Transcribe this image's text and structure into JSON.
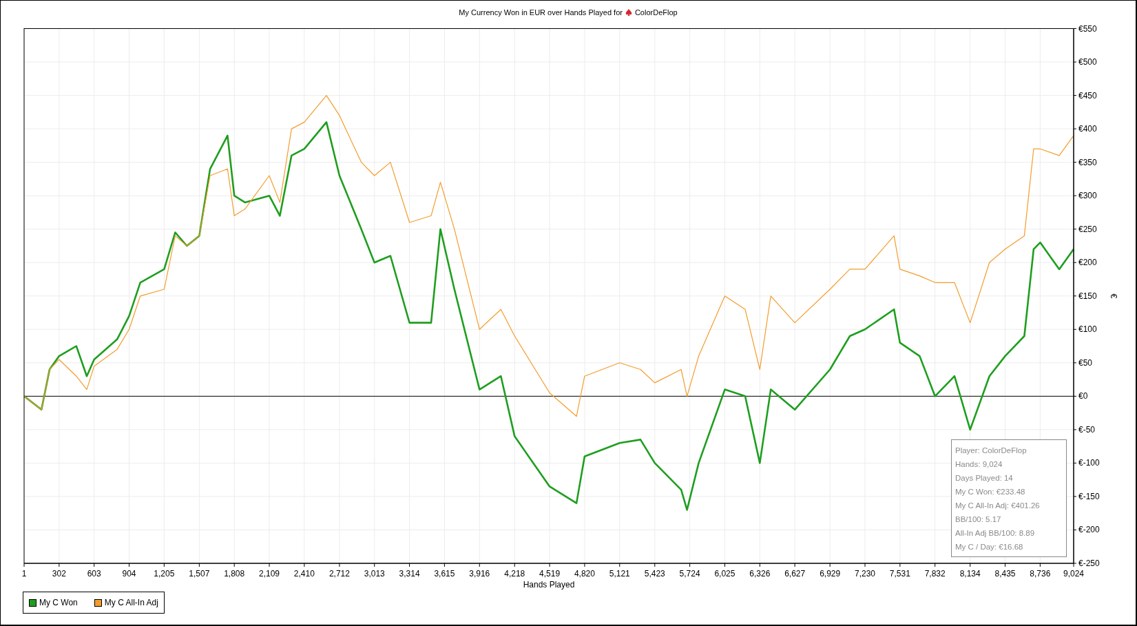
{
  "chart": {
    "chart_data": {
      "type": "line",
      "title": "My Currency Won in EUR over Hands Played for",
      "xlabel": "Hands Played",
      "ylabel": "€",
      "x": [
        1,
        150,
        220,
        302,
        450,
        540,
        603,
        800,
        904,
        1000,
        1205,
        1300,
        1400,
        1507,
        1600,
        1750,
        1808,
        1900,
        2109,
        2200,
        2300,
        2410,
        2600,
        2712,
        2900,
        3013,
        3150,
        3314,
        3500,
        3580,
        3700,
        3916,
        4100,
        4218,
        4519,
        4750,
        4820,
        5121,
        5300,
        5423,
        5650,
        5700,
        5800,
        6025,
        6200,
        6326,
        6420,
        6627,
        6929,
        7100,
        7230,
        7480,
        7531,
        7700,
        7832,
        8000,
        8134,
        8300,
        8435,
        8600,
        8680,
        8736,
        8900,
        9024
      ],
      "series": [
        {
          "name": "My C Won",
          "color": "#1e9e1e",
          "values": [
            0,
            -20,
            40,
            60,
            75,
            30,
            55,
            85,
            120,
            170,
            190,
            245,
            225,
            240,
            340,
            390,
            300,
            290,
            300,
            270,
            360,
            370,
            410,
            330,
            250,
            200,
            210,
            110,
            110,
            250,
            160,
            10,
            30,
            -60,
            -135,
            -160,
            -90,
            -70,
            -65,
            -100,
            -140,
            -170,
            -100,
            10,
            0,
            -100,
            10,
            -20,
            40,
            90,
            100,
            130,
            80,
            60,
            0,
            30,
            -50,
            30,
            60,
            90,
            220,
            230,
            190,
            220
          ]
        },
        {
          "name": "My C All-In Adj",
          "color": "#f39c2c",
          "values": [
            0,
            -20,
            40,
            55,
            30,
            10,
            45,
            70,
            100,
            150,
            160,
            240,
            225,
            240,
            330,
            340,
            270,
            280,
            330,
            290,
            400,
            410,
            450,
            420,
            350,
            330,
            350,
            260,
            270,
            320,
            250,
            100,
            130,
            90,
            5,
            -30,
            30,
            50,
            40,
            20,
            40,
            0,
            60,
            150,
            130,
            40,
            150,
            110,
            160,
            190,
            190,
            240,
            190,
            180,
            170,
            170,
            110,
            200,
            220,
            240,
            370,
            370,
            360,
            390
          ]
        }
      ],
      "grid": true,
      "xlim": [
        1,
        9024
      ],
      "ylim": [
        -250,
        550
      ],
      "xticks": [
        {
          "value": 1,
          "label": "1"
        },
        {
          "value": 302,
          "label": "302"
        },
        {
          "value": 603,
          "label": "603"
        },
        {
          "value": 904,
          "label": "904"
        },
        {
          "value": 1205,
          "label": "1,205"
        },
        {
          "value": 1507,
          "label": "1,507"
        },
        {
          "value": 1808,
          "label": "1,808"
        },
        {
          "value": 2109,
          "label": "2,109"
        },
        {
          "value": 2410,
          "label": "2,410"
        },
        {
          "value": 2712,
          "label": "2,712"
        },
        {
          "value": 3013,
          "label": "3,013"
        },
        {
          "value": 3314,
          "label": "3,314"
        },
        {
          "value": 3615,
          "label": "3,615"
        },
        {
          "value": 3916,
          "label": "3,916"
        },
        {
          "value": 4218,
          "label": "4,218"
        },
        {
          "value": 4519,
          "label": "4,519"
        },
        {
          "value": 4820,
          "label": "4,820"
        },
        {
          "value": 5121,
          "label": "5,121"
        },
        {
          "value": 5423,
          "label": "5,423"
        },
        {
          "value": 5724,
          "label": "5,724"
        },
        {
          "value": 6025,
          "label": "6,025"
        },
        {
          "value": 6326,
          "label": "6,326"
        },
        {
          "value": 6627,
          "label": "6,627"
        },
        {
          "value": 6929,
          "label": "6,929"
        },
        {
          "value": 7230,
          "label": "7,230"
        },
        {
          "value": 7531,
          "label": "7,531"
        },
        {
          "value": 7832,
          "label": "7,832"
        },
        {
          "value": 8134,
          "label": "8,134"
        },
        {
          "value": 8435,
          "label": "8,435"
        },
        {
          "value": 8736,
          "label": "8,736"
        },
        {
          "value": 9024,
          "label": "9,024"
        }
      ],
      "yticks": [
        {
          "value": -250,
          "label": "€-250"
        },
        {
          "value": -200,
          "label": "€-200"
        },
        {
          "value": -150,
          "label": "€-150"
        },
        {
          "value": -100,
          "label": "€-100"
        },
        {
          "value": -50,
          "label": "€-50"
        },
        {
          "value": 0,
          "label": "€0"
        },
        {
          "value": 50,
          "label": "€50"
        },
        {
          "value": 100,
          "label": "€100"
        },
        {
          "value": 150,
          "label": "€150"
        },
        {
          "value": 200,
          "label": "€200"
        },
        {
          "value": 250,
          "label": "€250"
        },
        {
          "value": 300,
          "label": "€300"
        },
        {
          "value": 350,
          "label": "€350"
        },
        {
          "value": 400,
          "label": "€400"
        },
        {
          "value": 450,
          "label": "€450"
        },
        {
          "value": 500,
          "label": "€500"
        },
        {
          "value": 550,
          "label": "€550"
        }
      ]
    },
    "player": "ColorDeFlop",
    "stats": [
      "Player: ColorDeFlop",
      "Hands: 9,024",
      "Days Played: 14",
      "My C Won: €233.48",
      "My C All-In Adj: €401.26",
      "BB/100: 5.17",
      "All-In Adj BB/100: 8.89",
      "My C / Day: €16.68"
    ]
  }
}
